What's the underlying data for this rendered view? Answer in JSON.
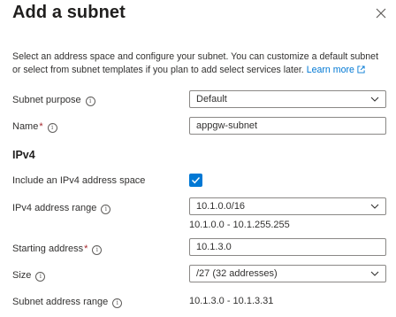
{
  "panel": {
    "title": "Add a subnet",
    "description": "Select an address space and configure your subnet. You can customize a default subnet or select from subnet templates if you plan to add select services later.",
    "learn_more": "Learn more"
  },
  "form": {
    "subnet_purpose": {
      "label": "Subnet purpose",
      "value": "Default"
    },
    "name": {
      "label": "Name",
      "required_mark": "*",
      "value": "appgw-subnet"
    },
    "ipv4_section": "IPv4",
    "include_ipv4": {
      "label": "Include an IPv4 address space",
      "checked": true
    },
    "ipv4_range": {
      "label": "IPv4 address range",
      "value": "10.1.0.0/16",
      "range_text": "10.1.0.0 - 10.1.255.255"
    },
    "starting_address": {
      "label": "Starting address",
      "required_mark": "*",
      "value": "10.1.3.0"
    },
    "size": {
      "label": "Size",
      "value": "/27 (32 addresses)"
    },
    "subnet_range": {
      "label": "Subnet address range",
      "value": "10.1.3.0 - 10.1.3.31"
    }
  },
  "colors": {
    "accent": "#0078d4",
    "border": "#8a8886",
    "text": "#323130"
  },
  "icons": {
    "close": "close-icon",
    "info": "info-icon",
    "external": "external-link-icon",
    "chevron": "chevron-down-icon",
    "check": "check-icon"
  }
}
